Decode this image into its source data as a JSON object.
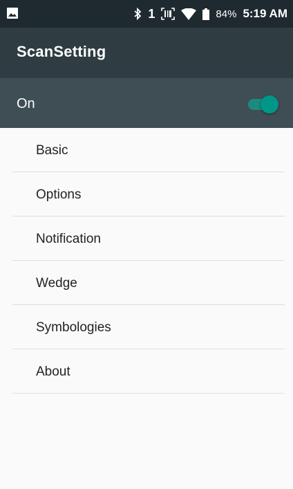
{
  "status_bar": {
    "sim_indicator": "1",
    "battery_percent": "84%",
    "time": "5:19 AM",
    "icons": [
      "image-notification-icon",
      "bluetooth-icon",
      "scanner-icon",
      "wifi-icon",
      "battery-icon"
    ]
  },
  "app_bar": {
    "title": "ScanSetting"
  },
  "master_switch": {
    "label": "On",
    "checked": true,
    "accent_color": "#009688"
  },
  "menu": {
    "items": [
      {
        "label": "Basic"
      },
      {
        "label": "Options"
      },
      {
        "label": "Notification"
      },
      {
        "label": "Wedge"
      },
      {
        "label": "Symbologies"
      },
      {
        "label": "About"
      }
    ]
  },
  "colors": {
    "status_bar": "#1f2a30",
    "app_bar": "#2f3c42",
    "switch_bar": "#3f4d54",
    "background": "#fafafa"
  }
}
